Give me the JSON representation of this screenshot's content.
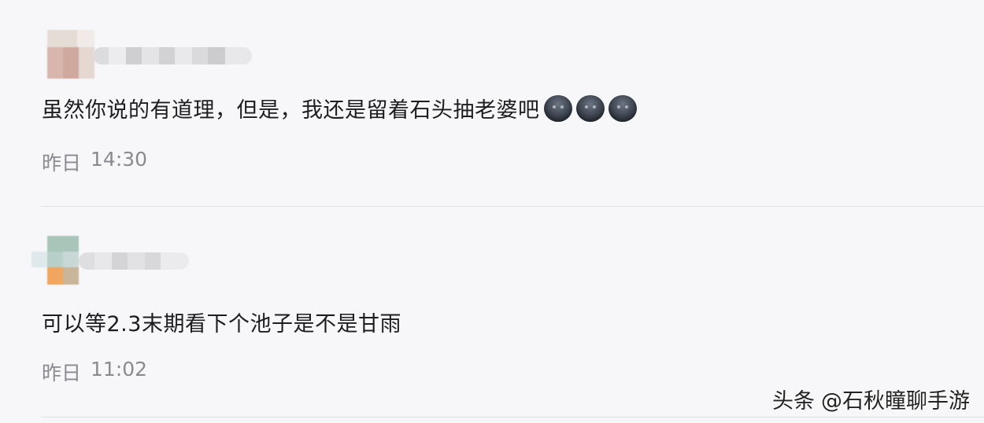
{
  "comments": [
    {
      "text": "虽然你说的有道理，但是，我还是留着石头抽老婆吧",
      "emojis": [
        "dark-face-emoji",
        "dark-face-emoji",
        "dark-face-emoji"
      ],
      "time_day": "昨日",
      "time_clock": "14:30"
    },
    {
      "text": "可以等2.3末期看下个池子是不是甘雨",
      "time_day": "昨日",
      "time_clock": "11:02"
    }
  ],
  "watermark": {
    "platform": "头条",
    "author": "@石秋瞳聊手游"
  },
  "colors": {
    "background": "#f7f7f9",
    "text": "#1d1d1f",
    "time": "#8a8a8f",
    "divider": "#e3e3e7"
  }
}
